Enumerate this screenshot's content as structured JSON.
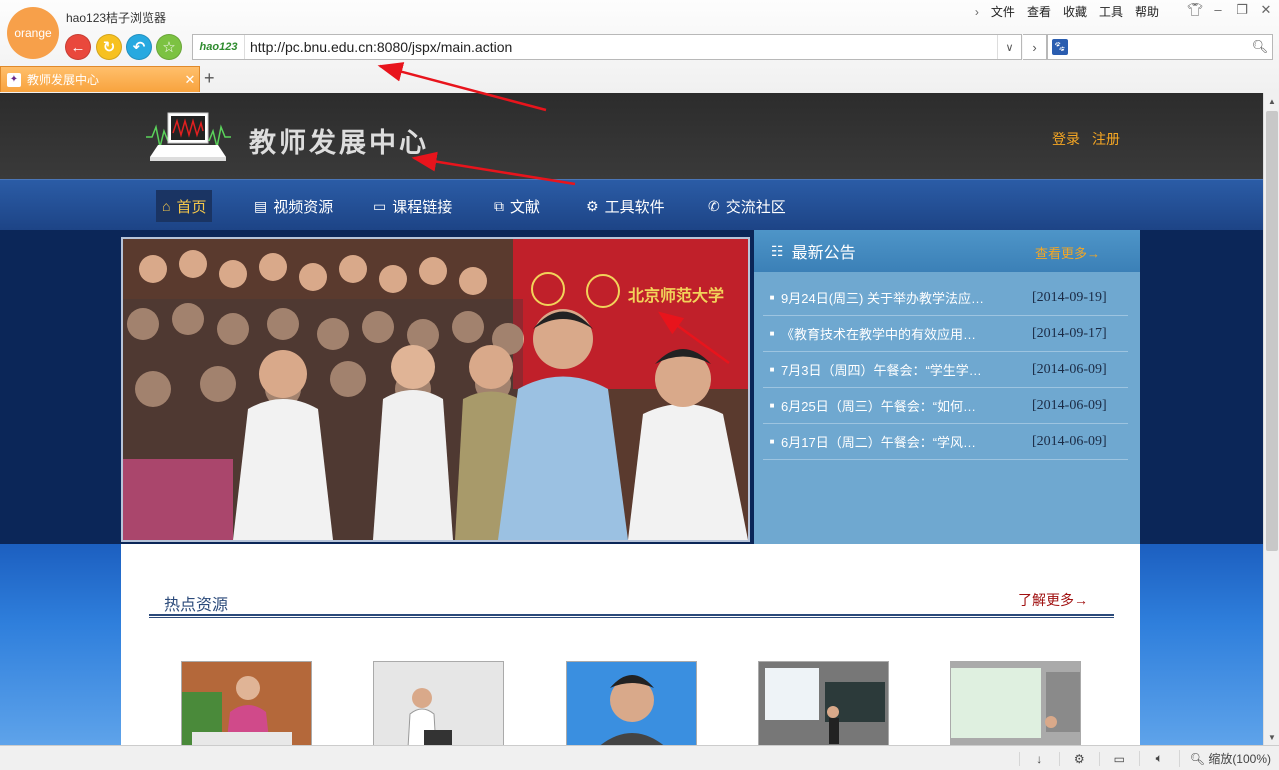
{
  "browser": {
    "logo_text": "orange",
    "app_title": "hao123桔子浏览器",
    "menu": [
      "文件",
      "查看",
      "收藏",
      "工具",
      "帮助"
    ],
    "address_logo": "hao123",
    "url": "http://pc.bnu.edu.cn:8080/jspx/main.action",
    "search_placeholder": "",
    "tab_label": "教师发展中心",
    "zoom": "缩放(100%)"
  },
  "site": {
    "name": "教师发展中心",
    "login": "登录",
    "register": "注册",
    "nav": [
      {
        "label": "首页",
        "icon": "home-icon"
      },
      {
        "label": "视频资源",
        "icon": "film-icon"
      },
      {
        "label": "课程链接",
        "icon": "monitor-icon"
      },
      {
        "label": "文献",
        "icon": "document-icon"
      },
      {
        "label": "工具软件",
        "icon": "gear-icon"
      },
      {
        "label": "交流社区",
        "icon": "phone-icon"
      }
    ]
  },
  "notices": {
    "title": "最新公告",
    "more": "查看更多",
    "items": [
      {
        "text": "9月24日(周三) 关于举办教学法应…",
        "date": "[2014-09-19]"
      },
      {
        "text": "《教育技术在教学中的有效应用…",
        "date": "[2014-09-17]"
      },
      {
        "text": "7月3日（周四）午餐会：“学生学…",
        "date": "[2014-06-09]"
      },
      {
        "text": "6月25日（周三）午餐会：“如何…",
        "date": "[2014-06-09]"
      },
      {
        "text": "6月17日（周二）午餐会：“学风…",
        "date": "[2014-06-09]"
      }
    ]
  },
  "hot": {
    "title": "热点资源",
    "more": "了解更多"
  },
  "photo": {
    "banner_text": "北京师范大学"
  },
  "colors": {
    "accent_orange": "#f5a623",
    "nav_blue": "#2b5ca6",
    "hero_navy": "#0b2658",
    "notice_blue": "#6fa8d0",
    "annotation_red": "#e8141c"
  }
}
